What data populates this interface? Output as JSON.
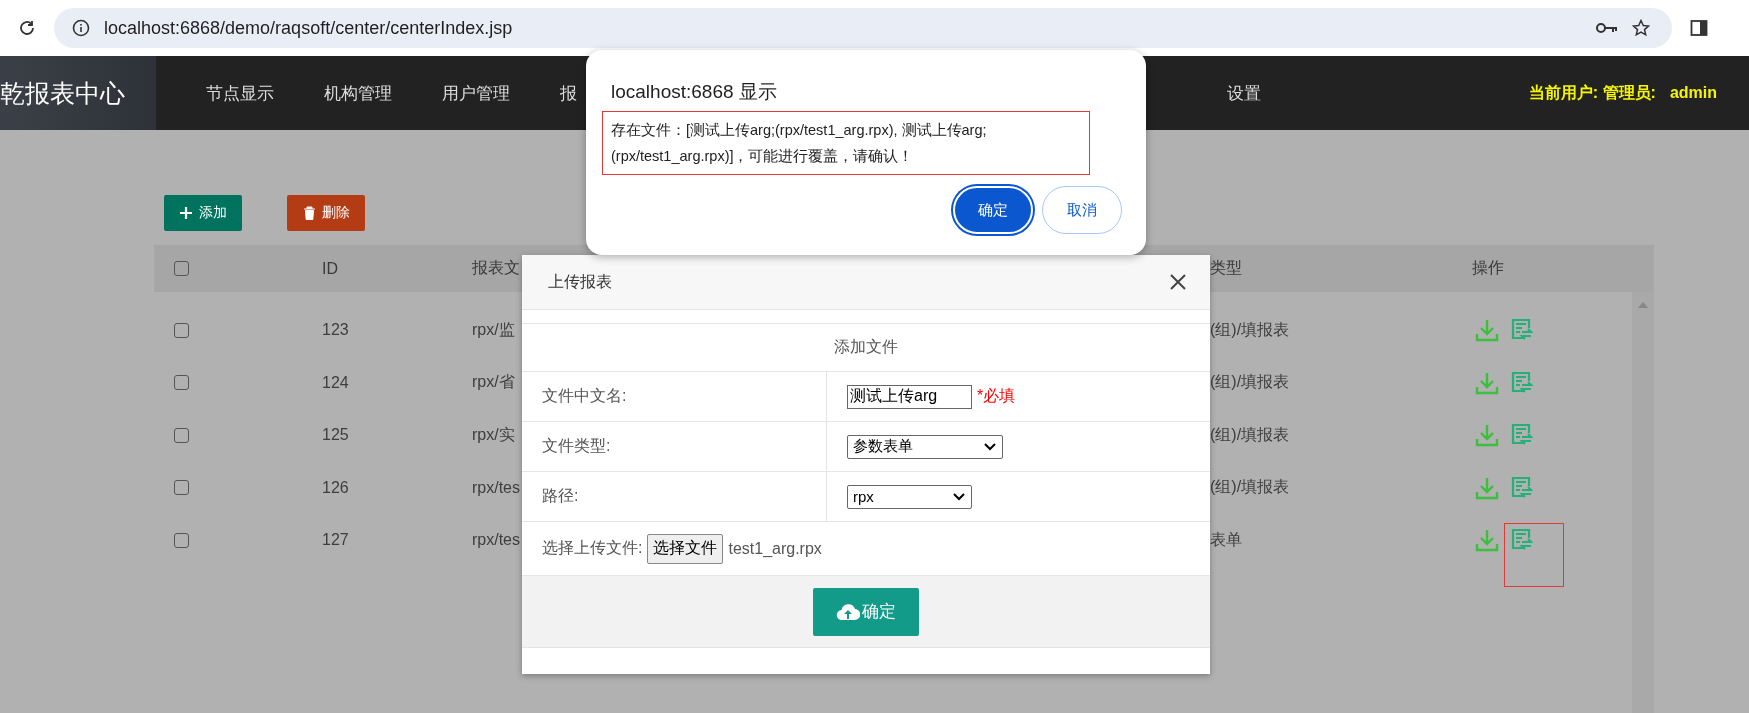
{
  "browser": {
    "url": "localhost:6868/demo/raqsoft/center/centerIndex.jsp"
  },
  "nav": {
    "logo": "乾报表中心",
    "items": [
      {
        "label": "节点显示"
      },
      {
        "label": "机构管理"
      },
      {
        "label": "用户管理"
      },
      {
        "label": "报"
      },
      {
        "label": "设置"
      }
    ],
    "user_label": "当前用户: 管理员:",
    "user_name": "admin"
  },
  "toolbar": [
    {
      "kind": "add",
      "label": "添加"
    },
    {
      "kind": "delete",
      "label": "删除"
    }
  ],
  "table": {
    "header_checked": false,
    "columns": [
      "ID",
      "报表文",
      "类型",
      "操作"
    ],
    "rows": [
      {
        "checked": false,
        "id": "123",
        "name": "rpx/监",
        "type": "(组)/填报表",
        "highlighted": false
      },
      {
        "checked": false,
        "id": "124",
        "name": "rpx/省",
        "type": "(组)/填报表",
        "highlighted": false
      },
      {
        "checked": false,
        "id": "125",
        "name": "rpx/实",
        "type": "(组)/填报表",
        "highlighted": false
      },
      {
        "checked": false,
        "id": "126",
        "name": "rpx/tes",
        "type": "(组)/填报表",
        "highlighted": false
      },
      {
        "checked": false,
        "id": "127",
        "name": "rpx/tes",
        "type": "表单",
        "highlighted": true
      }
    ]
  },
  "upload_dialog": {
    "title": "上传报表",
    "section": "添加文件",
    "fields": [
      {
        "kind": "text",
        "label": "文件中文名:",
        "value": "测试上传arg",
        "note": "*必填"
      },
      {
        "kind": "select",
        "label": "文件类型:",
        "value": "参数表单"
      },
      {
        "kind": "select",
        "label": "路径:",
        "value": "rpx"
      }
    ],
    "file": {
      "label": "选择上传文件:",
      "button": "选择文件",
      "filename": "test1_arg.rpx"
    },
    "submit": "确定"
  },
  "alert": {
    "title": "localhost:6868 显示",
    "message": "存在文件：[测试上传arg;(rpx/test1_arg.rpx), 测试上传arg;(rpx/test1_arg.rpx)]，可能进行覆盖，请确认！",
    "outlined": true,
    "buttons": [
      {
        "label": "确定",
        "primary": true
      },
      {
        "label": "取消",
        "primary": false
      }
    ]
  }
}
